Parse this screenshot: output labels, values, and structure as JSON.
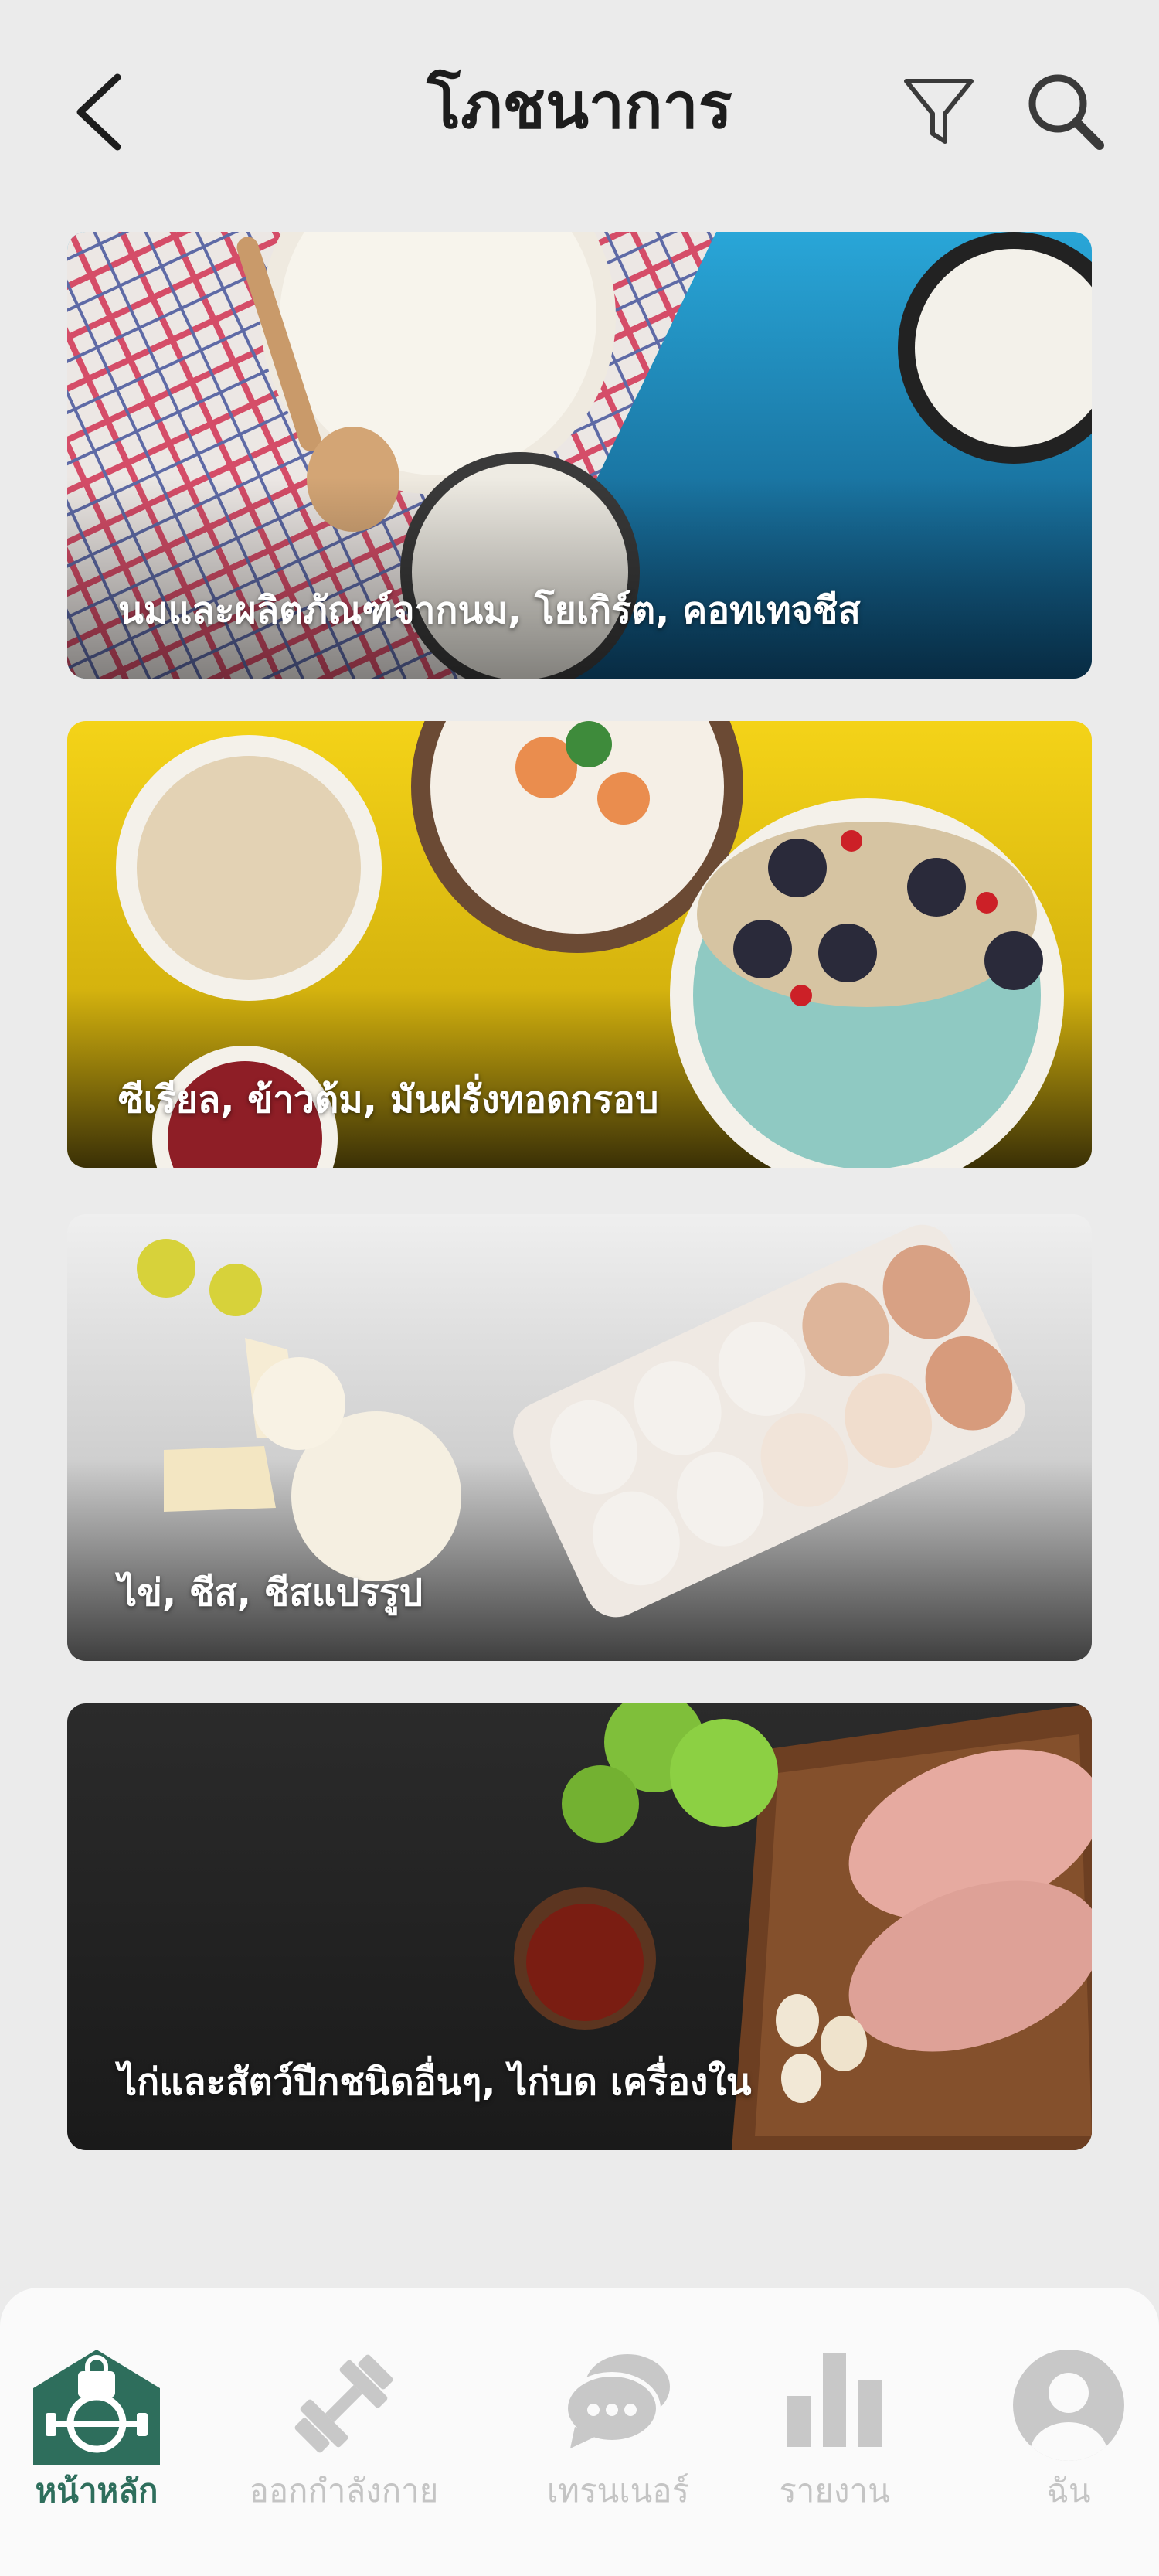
{
  "header": {
    "title": "โภชนาการ",
    "back_icon": "chevron-left-icon",
    "filter_icon": "filter-icon",
    "search_icon": "search-icon"
  },
  "categories": [
    {
      "label": "นมและผลิตภัณฑ์จากนม, โยเกิร์ต, คอทเทจชีส"
    },
    {
      "label": "ซีเรียล, ข้าวต้ม, มันฝรั่งทอดกรอบ"
    },
    {
      "label": "ไข่, ชีส, ชีสแปรรูป"
    },
    {
      "label": "ไก่และสัตว์ปีกชนิดอื่นๆ, ไก่บด เครื่องใน"
    }
  ],
  "tabbar": {
    "active_color": "#2e6e5c",
    "inactive_color": "#c4c4c4",
    "items": [
      {
        "label": "หน้าหลัก",
        "icon": "home-gym-icon",
        "active": true
      },
      {
        "label": "ออกกำลังกาย",
        "icon": "dumbbell-icon",
        "active": false
      },
      {
        "label": "เทรนเนอร์",
        "icon": "chat-bubbles-icon",
        "active": false
      },
      {
        "label": "รายงาน",
        "icon": "bar-chart-icon",
        "active": false
      },
      {
        "label": "ฉัน",
        "icon": "profile-icon",
        "active": false
      }
    ]
  }
}
